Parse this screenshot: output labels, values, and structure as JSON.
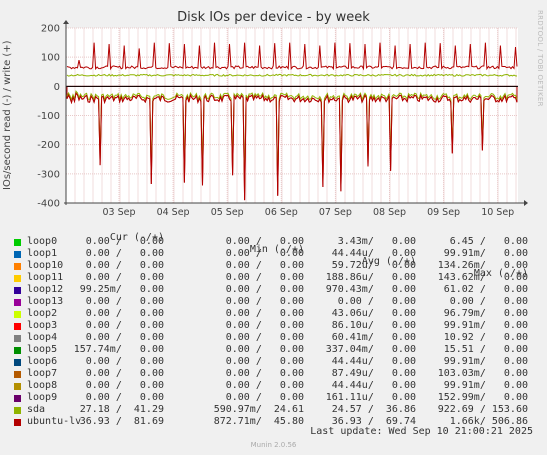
{
  "vertical_text": "RRDTOOL / TOBI OETIKER",
  "chart_data": {
    "type": "line",
    "title": "Disk IOs per device - by week",
    "ylabel": "IOs/second read (-) / write (+)",
    "xlabel": "",
    "ylim": [
      -400,
      200
    ],
    "yticks": [
      200,
      100,
      0,
      -100,
      -200,
      -300,
      -400
    ],
    "x_tick_labels": [
      "03 Sep",
      "04 Sep",
      "05 Sep",
      "06 Sep",
      "07 Sep",
      "08 Sep",
      "09 Sep",
      "10 Sep"
    ],
    "grid": true,
    "series_shape": {
      "sda_write": {
        "baseline": 38,
        "noise": 6
      },
      "ubuntu_write": {
        "baseline": 65,
        "noise": 10,
        "spike_peaks": [
          90,
          150,
          145,
          140,
          130,
          150,
          148,
          145,
          140,
          150,
          145,
          150,
          140,
          148,
          150,
          145,
          140,
          150,
          148,
          145,
          150,
          140,
          145,
          150,
          148,
          140,
          145,
          150,
          140,
          135
        ]
      },
      "ubuntu_read": {
        "baseline": -30,
        "noise": 25,
        "spike_troughs": [
          -270,
          -335,
          -330,
          -340,
          -305,
          -390,
          -375,
          -345,
          -360,
          -275,
          -290,
          -230,
          -220
        ]
      }
    }
  },
  "legend": {
    "headers": {
      "cur": "Cur (-/+)",
      "min": "Min (-/+)",
      "avg": "Avg (-/+)",
      "max": "Max (-/+)"
    },
    "rows": [
      {
        "name": "loop0",
        "color": "#00cc00",
        "cur": "0.00 /   0.00",
        "min": "0.00 /   0.00",
        "avg": "3.43m/   0.00",
        "max": "6.45 /   0.00"
      },
      {
        "name": "loop1",
        "color": "#0066b3",
        "cur": "0.00 /   0.00",
        "min": "0.00 /   0.00",
        "avg": "44.44u/   0.00",
        "max": "99.91m/   0.00"
      },
      {
        "name": "loop10",
        "color": "#ff8000",
        "cur": "0.00 /   0.00",
        "min": "0.00 /   0.00",
        "avg": "59.72u/   0.00",
        "max": "134.26m/   0.00"
      },
      {
        "name": "loop11",
        "color": "#ffcc00",
        "cur": "0.00 /   0.00",
        "min": "0.00 /   0.00",
        "avg": "188.86u/   0.00",
        "max": "143.62m/   0.00"
      },
      {
        "name": "loop12",
        "color": "#330099",
        "cur": "99.25m/   0.00",
        "min": "0.00 /   0.00",
        "avg": "970.43m/   0.00",
        "max": "61.02 /   0.00"
      },
      {
        "name": "loop13",
        "color": "#990099",
        "cur": "0.00 /   0.00",
        "min": "0.00 /   0.00",
        "avg": "0.00 /   0.00",
        "max": "0.00 /   0.00"
      },
      {
        "name": "loop2",
        "color": "#ccff00",
        "cur": "0.00 /   0.00",
        "min": "0.00 /   0.00",
        "avg": "43.06u/   0.00",
        "max": "96.79m/   0.00"
      },
      {
        "name": "loop3",
        "color": "#ff0000",
        "cur": "0.00 /   0.00",
        "min": "0.00 /   0.00",
        "avg": "86.10u/   0.00",
        "max": "99.91m/   0.00"
      },
      {
        "name": "loop4",
        "color": "#808080",
        "cur": "0.00 /   0.00",
        "min": "0.00 /   0.00",
        "avg": "60.41m/   0.00",
        "max": "10.92 /   0.00"
      },
      {
        "name": "loop5",
        "color": "#008f00",
        "cur": "157.74m/   0.00",
        "min": "0.00 /   0.00",
        "avg": "337.04m/   0.00",
        "max": "15.51 /   0.00"
      },
      {
        "name": "loop6",
        "color": "#00487d",
        "cur": "0.00 /   0.00",
        "min": "0.00 /   0.00",
        "avg": "44.44u/   0.00",
        "max": "99.91m/   0.00"
      },
      {
        "name": "loop7",
        "color": "#b35a00",
        "cur": "0.00 /   0.00",
        "min": "0.00 /   0.00",
        "avg": "87.49u/   0.00",
        "max": "103.03m/   0.00"
      },
      {
        "name": "loop8",
        "color": "#b38f00",
        "cur": "0.00 /   0.00",
        "min": "0.00 /   0.00",
        "avg": "44.44u/   0.00",
        "max": "99.91m/   0.00"
      },
      {
        "name": "loop9",
        "color": "#6b006b",
        "cur": "0.00 /   0.00",
        "min": "0.00 /   0.00",
        "avg": "161.11u/   0.00",
        "max": "152.99m/   0.00"
      },
      {
        "name": "sda",
        "color": "#8fb300",
        "cur": "27.18 /  41.29",
        "min": "590.97m/  24.61",
        "avg": "24.57 /  36.86",
        "max": "922.69 / 153.60"
      },
      {
        "name": "ubuntu-lv",
        "color": "#b30000",
        "cur": "36.93 /  81.69",
        "min": "872.71m/  45.80",
        "avg": "36.93 /  69.74",
        "max": "1.66k/ 506.86"
      }
    ]
  },
  "last_update": "Last update: Wed Sep 10 21:00:21 2025",
  "footer": "Munin 2.0.56"
}
